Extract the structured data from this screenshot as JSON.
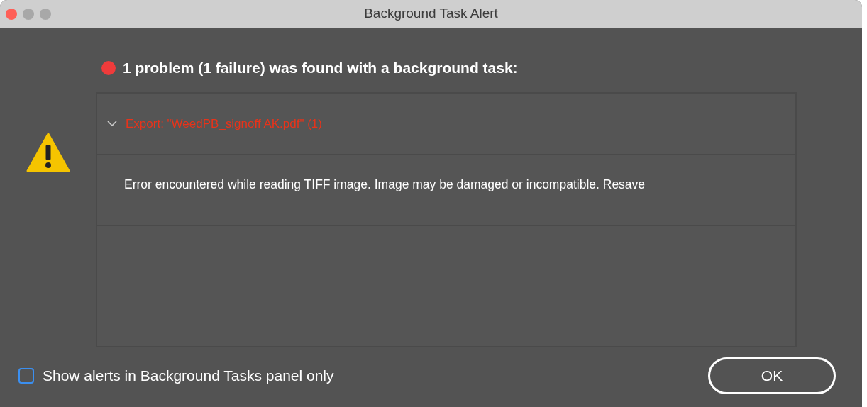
{
  "window": {
    "title": "Background Task Alert"
  },
  "summary": {
    "text": "1 problem (1 failure) was found with a background task:",
    "color": "#ef3b3b"
  },
  "tasks": [
    {
      "title": "Export: \"WeedPB_signoff AK.pdf\" (1)",
      "expanded": true,
      "messages": [
        "Error encountered while reading TIFF image. Image may be damaged or incompatible. Resave"
      ]
    }
  ],
  "option": {
    "label": "Show alerts in Background Tasks panel only",
    "checked": false
  },
  "buttons": [
    {
      "label": "OK"
    }
  ]
}
